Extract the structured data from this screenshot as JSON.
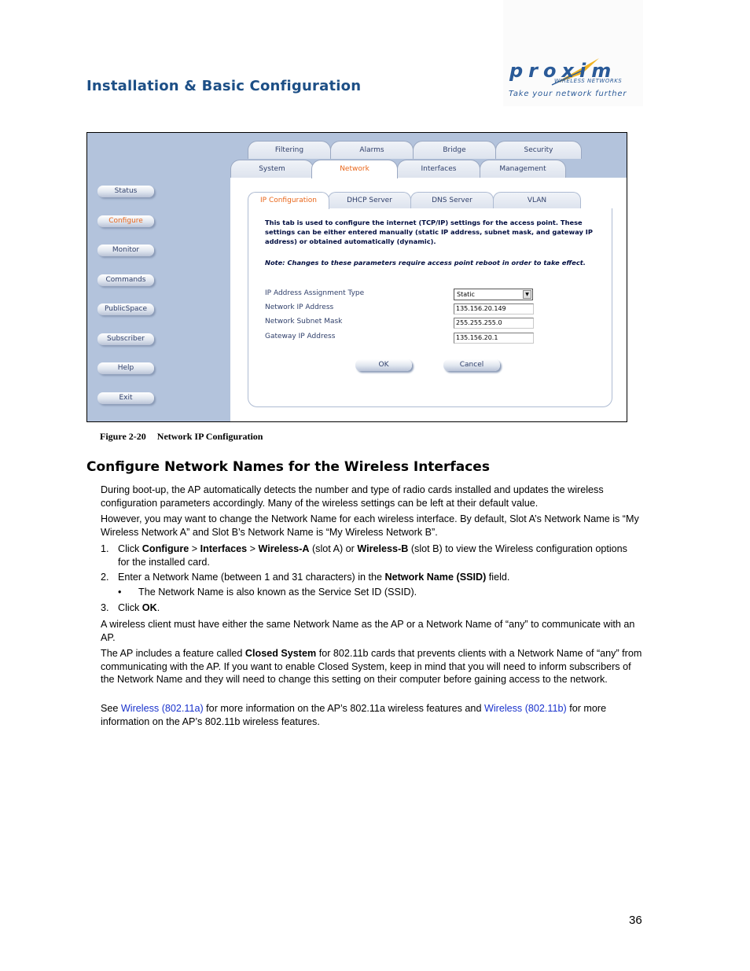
{
  "header": {
    "section_title": "Installation & Basic Configuration",
    "logo": {
      "brand": "proxim",
      "sub": "WIRELESS NETWORKS",
      "tagline": "Take your network further"
    }
  },
  "figure": {
    "sidebar": {
      "items": [
        {
          "label": "Status",
          "active": false
        },
        {
          "label": "Configure",
          "active": true
        },
        {
          "label": "Monitor",
          "active": false
        },
        {
          "label": "Commands",
          "active": false
        },
        {
          "label": "PublicSpace",
          "active": false
        },
        {
          "label": "Subscriber",
          "active": false
        },
        {
          "label": "Help",
          "active": false
        },
        {
          "label": "Exit",
          "active": false
        }
      ]
    },
    "tabs_row1": [
      "Filtering",
      "Alarms",
      "Bridge",
      "Security"
    ],
    "tabs_row2": [
      "System",
      "Network",
      "Interfaces",
      "Management"
    ],
    "active_tab": "Network",
    "sub_tabs": [
      "IP Configuration",
      "DHCP Server",
      "DNS Server",
      "VLAN"
    ],
    "active_sub_tab": "IP Configuration",
    "description": "This tab is used to configure the internet (TCP/IP) settings for the access point. These settings can be either entered manually (static IP address, subnet mask, and gateway IP address) or obtained automatically (dynamic).",
    "note": "Note: Changes to these parameters require access point reboot in order to take effect.",
    "fields": {
      "assignment_type": {
        "label": "IP Address Assignment Type",
        "value": "Static"
      },
      "ip_address": {
        "label": "Network IP Address",
        "value": "135.156.20.149"
      },
      "subnet_mask": {
        "label": "Network Subnet Mask",
        "value": "255.255.255.0"
      },
      "gateway": {
        "label": "Gateway IP Address",
        "value": "135.156.20.1"
      }
    },
    "ok_label": "OK",
    "cancel_label": "Cancel",
    "accent_color": "#e9661a"
  },
  "caption": {
    "number": "Figure 2-20",
    "title": "Network IP Configuration"
  },
  "section": {
    "heading": "Configure Network Names for the Wireless Interfaces",
    "p1": "During boot-up, the AP automatically detects the number and type of radio cards installed and updates the wireless configuration parameters accordingly. Many of the wireless settings can be left at their default value.",
    "p2": " However, you may want to change the Network Name for each wireless interface. By default, Slot A’s Network Name is “My Wireless Network A” and Slot B’s Network Name is “My Wireless Network B”.",
    "step1": {
      "num": "1.",
      "t1": "Click ",
      "b1": "Configure",
      "t2": " > ",
      "b2": "Interfaces",
      "t3": " > ",
      "b3": "Wireless-A",
      "t4": " (slot A) or ",
      "b4": "Wireless-B",
      "t5": " (slot B) to view the Wireless configuration options for the installed card."
    },
    "step2": {
      "num": "2.",
      "t1": "Enter a Network Name (between 1 and 31 characters) in the ",
      "b1": "Network Name (SSID)",
      "t2": " field.",
      "bullet": "The Network Name is also known as the Service Set ID (SSID)."
    },
    "step3": {
      "num": "3.",
      "t1": "Click ",
      "b1": "OK",
      "t2": "."
    },
    "p3": "A wireless client must have either the same Network Name as the AP or a Network Name of “any” to communicate with an AP.",
    "p4": {
      "t1": "The AP includes a feature called ",
      "b1": "Closed System",
      "t2": " for 802.11b cards that prevents clients with a Network Name of “any” from communicating with the AP. If you want to enable Closed System, keep in mind that you will need to inform subscribers of the Network Name and they will need to change this setting on their computer before gaining access to the network."
    },
    "p5": {
      "t1": "See ",
      "link1": "Wireless (802.11a)",
      "t2": " for more information on the AP’s 802.11a wireless features and ",
      "link2": "Wireless (802.11b)",
      "t3": " for more information on the AP’s 802.11b wireless features."
    },
    "link_color": "#1a33cc"
  },
  "page_number": "36"
}
